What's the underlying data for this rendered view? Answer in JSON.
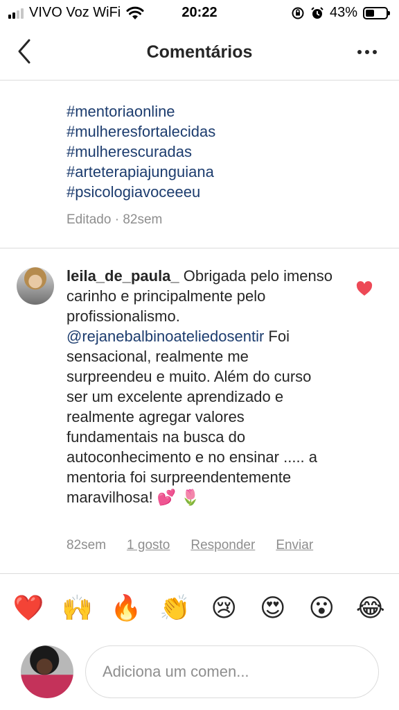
{
  "status_bar": {
    "carrier": "VIVO Voz WiFi",
    "time": "20:22",
    "battery": "43%",
    "battery_level": 0.43,
    "signal_bars_on": 2,
    "signal_bars_total": 4
  },
  "header": {
    "title": "Comentários",
    "back_icon": "chevron-left-icon",
    "more_icon": "ellipsis-icon"
  },
  "caption": {
    "hashtags": [
      "#mentoriaonline",
      "#mulheresfortalecidas",
      "#mulherescuradas",
      "#arteterapiajunguiana",
      "#psicologiavoceeeu"
    ],
    "meta": "Editado · 82sem"
  },
  "comment": {
    "username": "leila_de_paula_",
    "text_before_mention": " Obrigada pelo imenso carinho e principalmente pelo profissionalismo. ",
    "mention": "@rejanebalbinoateliedosentir",
    "text_after_mention": " Foi sensacional, realmente me surpreendeu e muito. Além do curso ser um excelente aprendizado e realmente agregar valores fundamentais na busca do autoconhecimento e no ensinar ..... a mentoria foi surpreendentemente maravilhosa! ",
    "emojis": "💕 🌷",
    "liked": true,
    "like_color": "#ed4956",
    "time": "82sem",
    "likes_label": "1 gosto",
    "reply_label": "Responder",
    "send_label": "Enviar"
  },
  "reactions": [
    "❤️",
    "🙌",
    "🔥",
    "👏",
    "😢",
    "😍",
    "😮",
    "😂"
  ],
  "input": {
    "placeholder": "Adiciona um comen..."
  },
  "colors": {
    "link": "#1c3c6e",
    "muted": "#8e8e8e",
    "divider": "#dbdbdb"
  }
}
